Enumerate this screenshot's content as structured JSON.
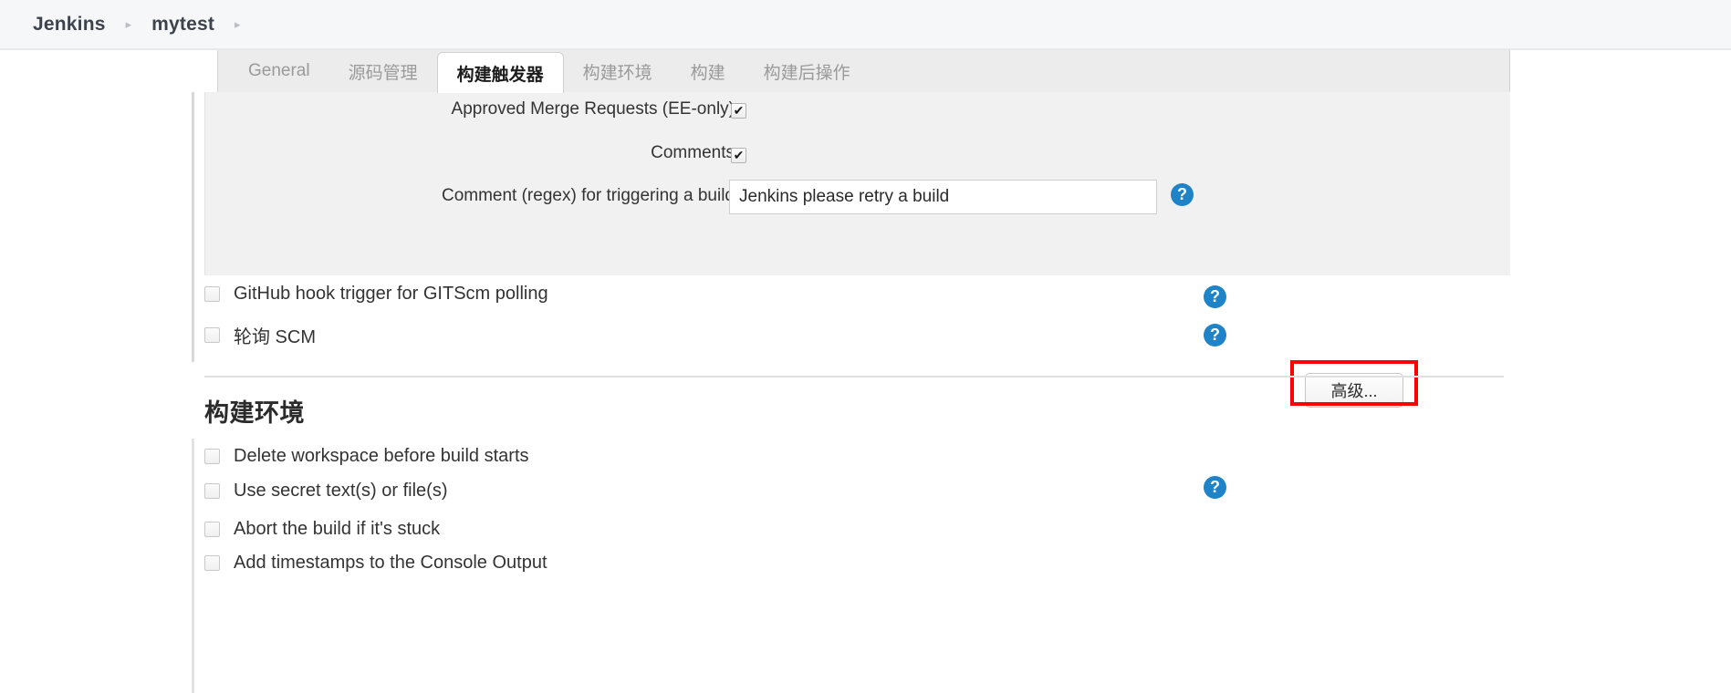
{
  "breadcrumb": {
    "items": [
      {
        "label": "Jenkins"
      },
      {
        "label": "mytest"
      }
    ],
    "separator": "▸"
  },
  "tabs": [
    {
      "label": "General",
      "active": false
    },
    {
      "label": "源码管理",
      "active": false
    },
    {
      "label": "构建触发器",
      "active": true
    },
    {
      "label": "构建环境",
      "active": false
    },
    {
      "label": "构建",
      "active": false
    },
    {
      "label": "构建后操作",
      "active": false
    }
  ],
  "trigger_panel": {
    "rows": [
      {
        "label": "Approved Merge Requests (EE-only)",
        "checked": true
      },
      {
        "label": "Comments",
        "checked": true
      }
    ],
    "comment_regex": {
      "label": "Comment (regex) for triggering a build",
      "value": "Jenkins please retry a build",
      "placeholder": "",
      "help_icon": "help-icon"
    },
    "advanced_button": {
      "label": "高级...",
      "highlight_color": "#ff0000"
    }
  },
  "trigger_options": [
    {
      "label": "GitHub hook trigger for GITScm polling",
      "checked": false,
      "help": "?"
    },
    {
      "label": "轮询 SCM",
      "checked": false,
      "help": "?"
    }
  ],
  "build_env": {
    "title": "构建环境",
    "options": [
      {
        "label": "Delete workspace before build starts",
        "checked": false,
        "help": ""
      },
      {
        "label": "Use secret text(s) or file(s)",
        "checked": false,
        "help": "?"
      },
      {
        "label": "Abort the build if it's stuck",
        "checked": false,
        "help": ""
      },
      {
        "label": "Add timestamps to the Console Output",
        "checked": false,
        "help": ""
      }
    ]
  },
  "icons": {
    "help": "?"
  },
  "colors": {
    "accent": "#1f83c8",
    "highlight": "#ff0000",
    "panel_bg": "#f1f1f1",
    "tab_bg": "#ececec"
  }
}
